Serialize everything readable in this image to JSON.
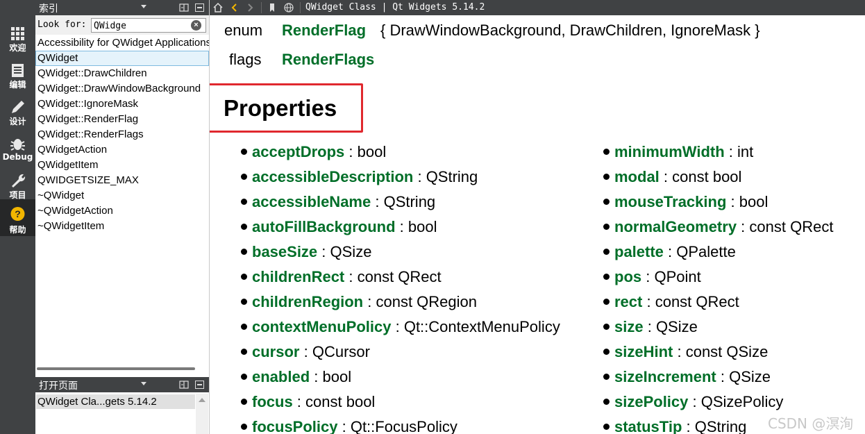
{
  "modebar": {
    "items": [
      {
        "label": "欢迎",
        "icon": "grid-icon"
      },
      {
        "label": "编辑",
        "icon": "document-icon"
      },
      {
        "label": "设计",
        "icon": "pencil-icon"
      },
      {
        "label": "Debug",
        "icon": "bug-icon"
      },
      {
        "label": "项目",
        "icon": "wrench-icon"
      },
      {
        "label": "帮助",
        "icon": "help-icon"
      }
    ],
    "active_index": 5
  },
  "index_pane": {
    "title": "索引",
    "lookfor_label": "Look for:",
    "search_value": "QWidge",
    "items": [
      "Accessibility for QWidget Applications",
      "QWidget",
      "QWidget::DrawChildren",
      "QWidget::DrawWindowBackground",
      "QWidget::IgnoreMask",
      "QWidget::RenderFlag",
      "QWidget::RenderFlags",
      "QWidgetAction",
      "QWidgetItem",
      "QWIDGETSIZE_MAX",
      "~QWidget",
      "~QWidgetAction",
      "~QWidgetItem"
    ],
    "selected_index": 1
  },
  "open_pages": {
    "title": "打开页面",
    "items": [
      "QWidget Cla...gets 5.14.2"
    ]
  },
  "toolbar": {
    "doc_title": "QWidget Class | Qt Widgets 5.14.2"
  },
  "content": {
    "decls": [
      {
        "kw": "enum",
        "name": "RenderFlag",
        "rest": "{ DrawWindowBackground, DrawChildren, IgnoreMask }"
      },
      {
        "kw": "flags",
        "name": "RenderFlags",
        "rest": ""
      }
    ],
    "heading": "Properties",
    "left_props": [
      {
        "name": "acceptDrops",
        "type": "bool"
      },
      {
        "name": "accessibleDescription",
        "type": "QString"
      },
      {
        "name": "accessibleName",
        "type": "QString"
      },
      {
        "name": "autoFillBackground",
        "type": "bool"
      },
      {
        "name": "baseSize",
        "type": "QSize"
      },
      {
        "name": "childrenRect",
        "type": "const QRect"
      },
      {
        "name": "childrenRegion",
        "type": "const QRegion"
      },
      {
        "name": "contextMenuPolicy",
        "type": "Qt::ContextMenuPolicy"
      },
      {
        "name": "cursor",
        "type": "QCursor"
      },
      {
        "name": "enabled",
        "type": "bool"
      },
      {
        "name": "focus",
        "type": "const bool"
      },
      {
        "name": "focusPolicy",
        "type": "Qt::FocusPolicy"
      }
    ],
    "right_props": [
      {
        "name": "minimumWidth",
        "type": "int"
      },
      {
        "name": "modal",
        "type": "const bool"
      },
      {
        "name": "mouseTracking",
        "type": "bool"
      },
      {
        "name": "normalGeometry",
        "type": "const QRect"
      },
      {
        "name": "palette",
        "type": "QPalette"
      },
      {
        "name": "pos",
        "type": "QPoint"
      },
      {
        "name": "rect",
        "type": "const QRect"
      },
      {
        "name": "size",
        "type": "QSize"
      },
      {
        "name": "sizeHint",
        "type": "const QSize"
      },
      {
        "name": "sizeIncrement",
        "type": "QSize"
      },
      {
        "name": "sizePolicy",
        "type": "QSizePolicy"
      },
      {
        "name": "statusTip",
        "type": "QString"
      }
    ]
  },
  "watermark": "CSDN @溟洵",
  "colors": {
    "link_green": "#006e28",
    "toolbar_bg": "#404244",
    "highlight_border": "#e0282e"
  }
}
